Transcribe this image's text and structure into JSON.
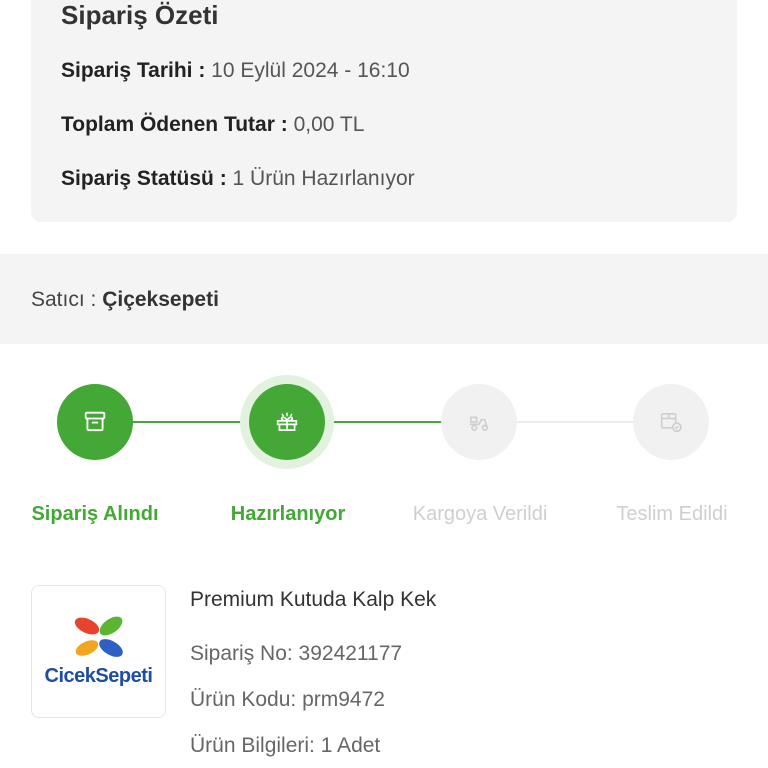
{
  "summary": {
    "title": "Sipariş Özeti",
    "date_label": "Sipariş Tarihi :",
    "date_value": "10 Eylül 2024 - 16:10",
    "total_label": "Toplam Ödenen Tutar :",
    "total_value": "0,00 TL",
    "status_label": "Sipariş Statüsü :",
    "status_value": "1 Ürün Hazırlanıyor"
  },
  "seller": {
    "label": "Satıcı :",
    "name": "Çiçeksepeti"
  },
  "steps": [
    {
      "label": "Sipariş Alındı",
      "state": "done",
      "icon": "box-icon"
    },
    {
      "label": "Hazırlanıyor",
      "state": "active",
      "icon": "gift-icon"
    },
    {
      "label": "Kargoya Verildi",
      "state": "todo",
      "icon": "courier-icon"
    },
    {
      "label": "Teslim Edildi",
      "state": "todo",
      "icon": "delivered-package-icon"
    }
  ],
  "product": {
    "brand_logo": "CicekSepeti",
    "name": "Premium Kutuda Kalp Kek",
    "order_no": "Sipariş No: 392421177",
    "product_code": "Ürün Kodu: prm9472",
    "info": "Ürün Bilgileri: 1 Adet"
  },
  "colors": {
    "accent": "#43a836",
    "inactive": "#cfcfcf",
    "panel": "#f4f4f4"
  }
}
